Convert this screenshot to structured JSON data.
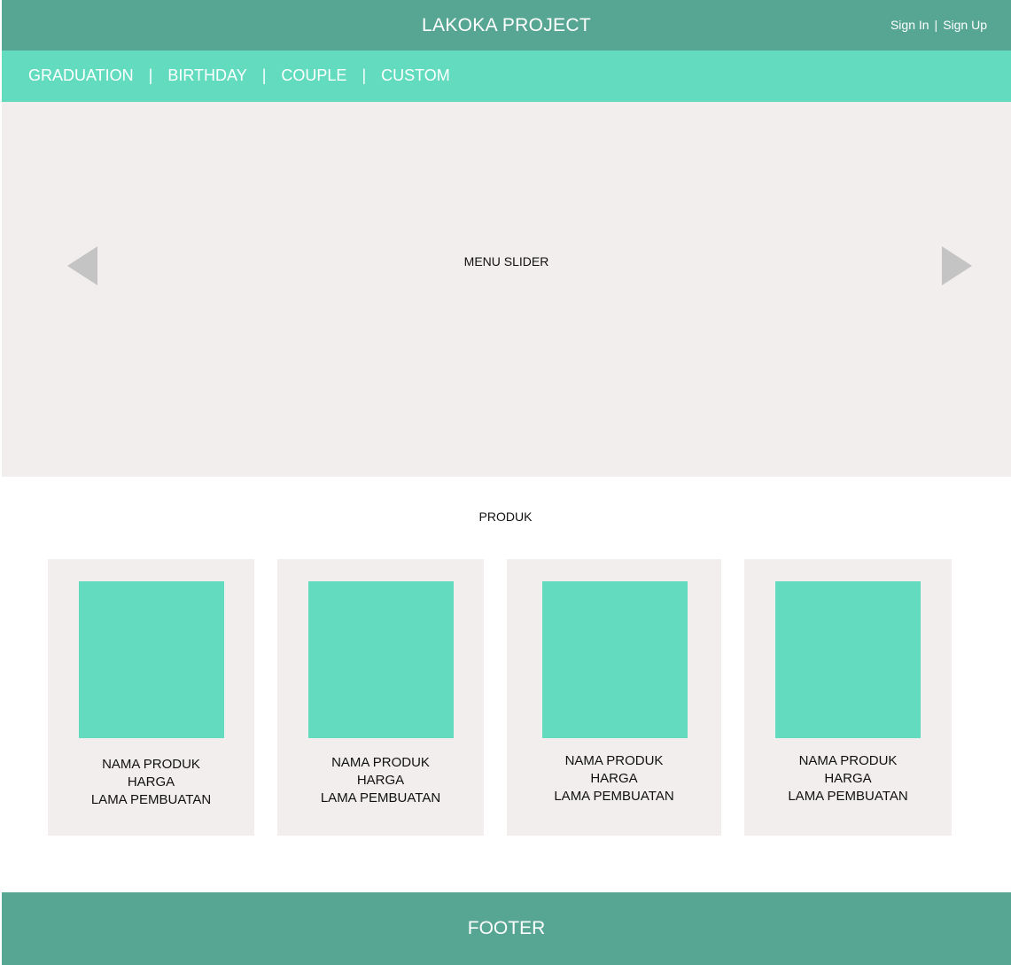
{
  "header": {
    "title": "LAKOKA PROJECT",
    "sign_in": "Sign In",
    "separator": "|",
    "sign_up": "Sign Up"
  },
  "nav": {
    "items": [
      "GRADUATION",
      "BIRTHDAY",
      "COUPLE",
      "CUSTOM"
    ],
    "separator": "|"
  },
  "slider": {
    "label": "MENU SLIDER"
  },
  "products": {
    "title": "PRODUK",
    "cards": [
      {
        "name": "NAMA PRODUK",
        "price": "HARGA",
        "duration": "LAMA PEMBUATAN"
      },
      {
        "name": "NAMA PRODUK",
        "price": "HARGA",
        "duration": "LAMA PEMBUATAN"
      },
      {
        "name": "NAMA PRODUK",
        "price": "HARGA",
        "duration": "LAMA PEMBUATAN"
      },
      {
        "name": "NAMA PRODUK",
        "price": "HARGA",
        "duration": "LAMA PEMBUATAN"
      }
    ]
  },
  "footer": {
    "label": "FOOTER"
  },
  "colors": {
    "header_bg": "#57a693",
    "nav_bg": "#62dbbf",
    "panel_bg": "#f1eeed",
    "image_placeholder": "#62dbbf",
    "arrow": "#c4c4c4"
  },
  "icons": {
    "prev": "triangle-left-icon",
    "next": "triangle-right-icon"
  }
}
